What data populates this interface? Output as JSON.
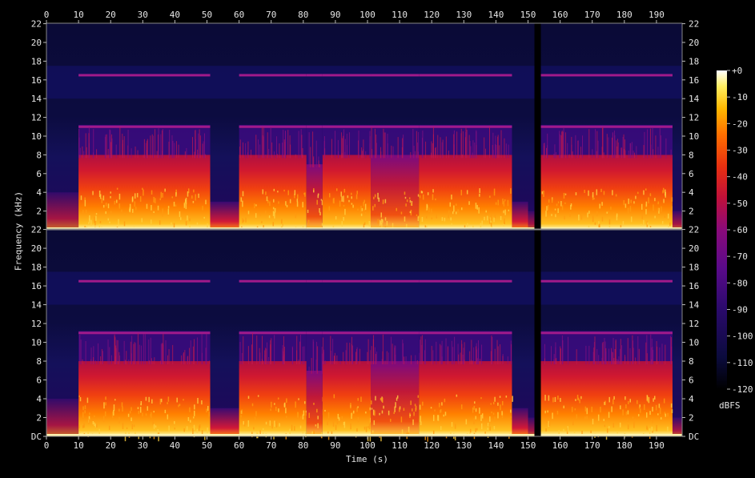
{
  "chart_data": {
    "type": "heatmap",
    "title": "",
    "xlabel": "Time (s)",
    "ylabel": "Frequency (kHz)",
    "x_range": [
      0,
      198
    ],
    "x_ticks": [
      0,
      10,
      20,
      30,
      40,
      50,
      60,
      70,
      80,
      90,
      100,
      110,
      120,
      130,
      140,
      150,
      160,
      170,
      180,
      190
    ],
    "y_range_khz": [
      0,
      22.05
    ],
    "y_ticks_top": [
      "2",
      "4",
      "6",
      "8",
      "10",
      "12",
      "14",
      "16",
      "18",
      "20",
      "22"
    ],
    "y_ticks_bottom": [
      "DC",
      "2",
      "4",
      "6",
      "8",
      "10",
      "12",
      "14",
      "16",
      "18",
      "20",
      "22"
    ],
    "channels": 2,
    "colorbar": {
      "label": "dBFS",
      "range": [
        -120,
        0
      ],
      "ticks": [
        "+0",
        "-10",
        "-20",
        "-30",
        "-40",
        "-50",
        "-60",
        "-70",
        "-80",
        "-90",
        "-100",
        "-110",
        "-120"
      ]
    },
    "segments": [
      {
        "start": 0,
        "end": 10,
        "level": "low",
        "top_khz": 4
      },
      {
        "start": 10,
        "end": 51,
        "level": "loud",
        "top_khz": 8
      },
      {
        "start": 51,
        "end": 60,
        "level": "quiet",
        "top_khz": 3
      },
      {
        "start": 60,
        "end": 81,
        "level": "loud",
        "top_khz": 8
      },
      {
        "start": 81,
        "end": 86,
        "level": "medium",
        "top_khz": 7
      },
      {
        "start": 86,
        "end": 101,
        "level": "loud",
        "top_khz": 8
      },
      {
        "start": 101,
        "end": 116,
        "level": "medium",
        "top_khz": 8
      },
      {
        "start": 116,
        "end": 145,
        "level": "loud",
        "top_khz": 8
      },
      {
        "start": 145,
        "end": 150,
        "level": "quiet",
        "top_khz": 3
      },
      {
        "start": 150,
        "end": 152,
        "level": "low",
        "top_khz": 2
      },
      {
        "start": 152,
        "end": 154,
        "level": "silence",
        "top_khz": 0
      },
      {
        "start": 154,
        "end": 195,
        "level": "loud",
        "top_khz": 8
      },
      {
        "start": 195,
        "end": 198,
        "level": "low",
        "top_khz": 2
      }
    ],
    "tonal_lines_khz": [
      11,
      16.5
    ],
    "colors": {
      "background": "#000000",
      "floor": "#0a0a3a",
      "colormap": [
        "#000000",
        "#0b0b3d",
        "#2a0a6b",
        "#5a0a8a",
        "#8a0a7a",
        "#c0103a",
        "#e83010",
        "#ff7000",
        "#ffb800",
        "#ffee60",
        "#ffffff"
      ]
    }
  }
}
